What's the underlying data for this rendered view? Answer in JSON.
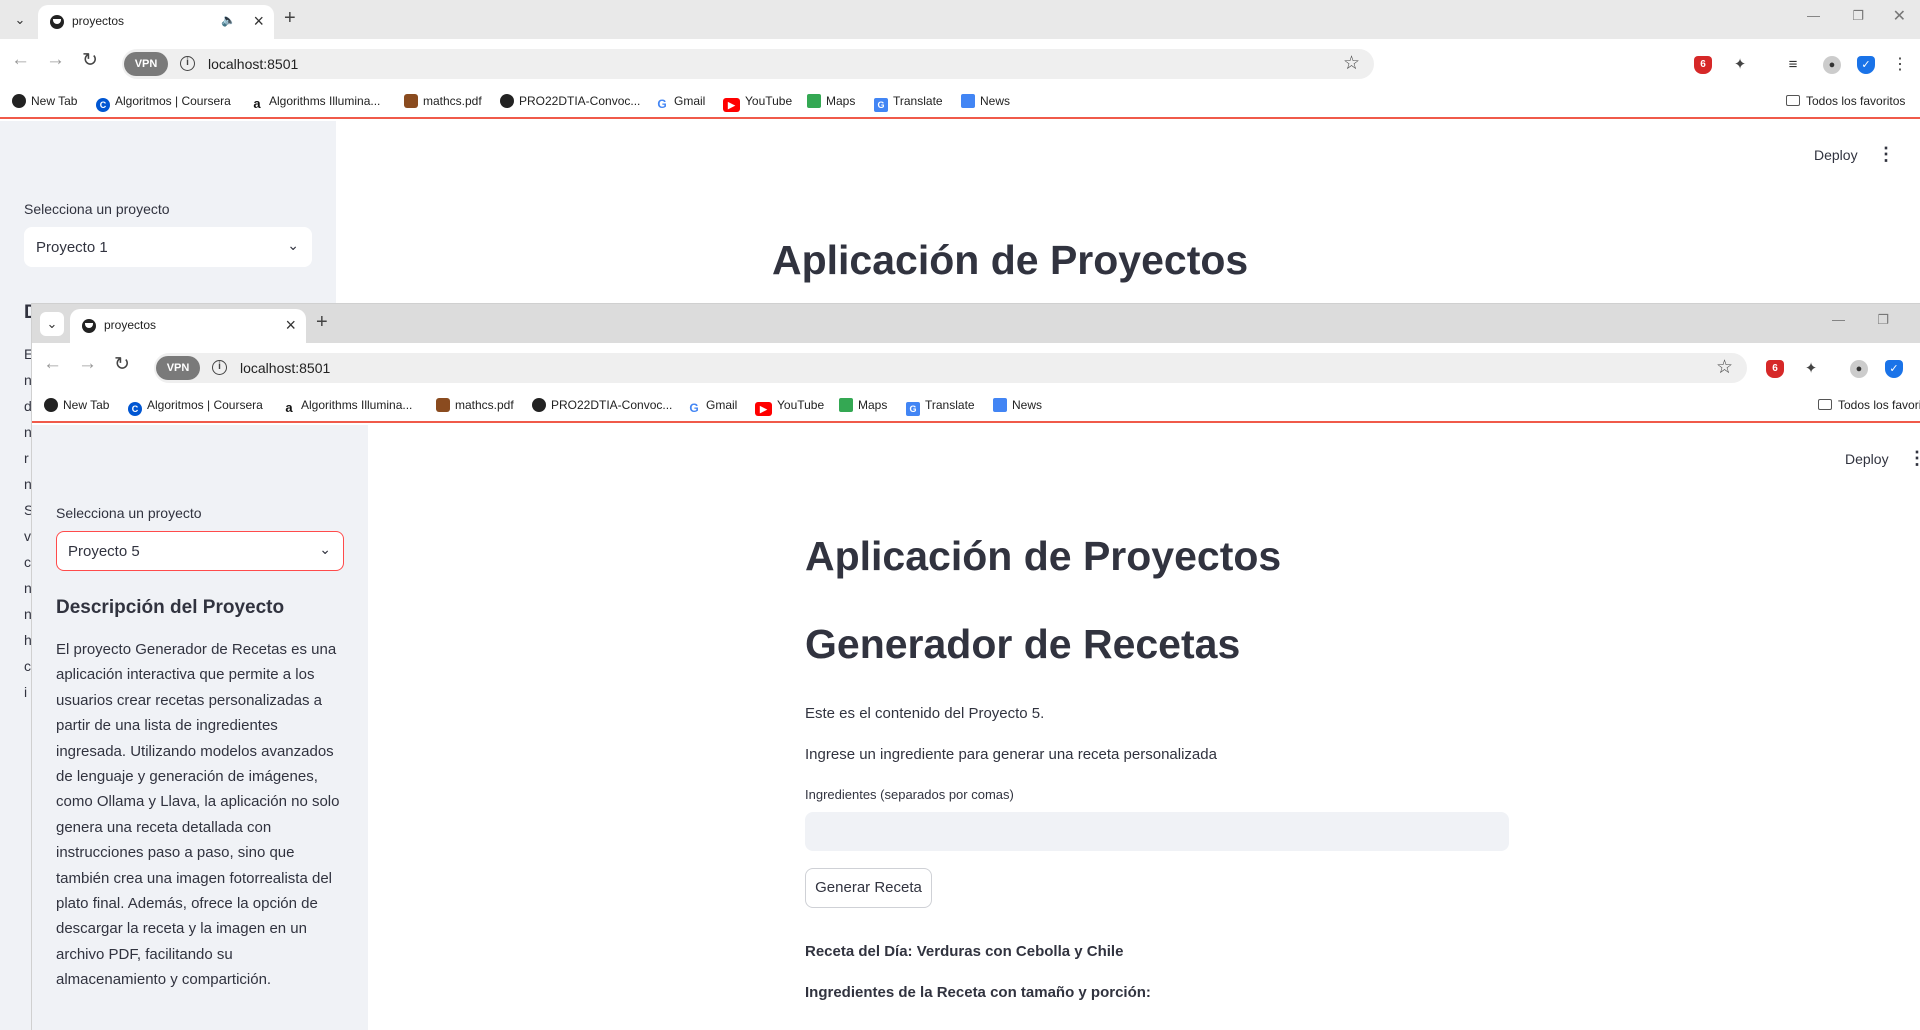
{
  "browser": {
    "tab_title": "proyectos",
    "url": "localhost:8501",
    "vpn_label": "VPN",
    "new_tab_symbol": "+",
    "bookmarks": [
      {
        "label": "New Tab",
        "icon": "globe-icon",
        "color": "#222222"
      },
      {
        "label": "Algoritmos | Coursera",
        "icon": "coursera-icon",
        "color": "#0056d2"
      },
      {
        "label": "Algorithms Illumina...",
        "icon": "amazon-icon",
        "color": "#111111"
      },
      {
        "label": "mathcs.pdf",
        "icon": "shield-crest-icon",
        "color": "#8a4b1f"
      },
      {
        "label": "PRO22DTIA-Convoc...",
        "icon": "globe-icon",
        "color": "#222222"
      },
      {
        "label": "Gmail",
        "icon": "google-icon",
        "color": "#4285f4"
      },
      {
        "label": "YouTube",
        "icon": "youtube-icon",
        "color": "#ff0000"
      },
      {
        "label": "Maps",
        "icon": "maps-icon",
        "color": "#34a853"
      },
      {
        "label": "Translate",
        "icon": "translate-icon",
        "color": "#4285f4"
      },
      {
        "label": "News",
        "icon": "news-icon",
        "color": "#4285f4"
      }
    ],
    "bookmarks_folder": "Todos los favoritos",
    "bookmarks_folder_front": "Todos los favori"
  },
  "app": {
    "deploy_label": "Deploy",
    "title": "Aplicación de Proyectos",
    "back": {
      "select_label": "Selecciona un proyecto",
      "select_value": "Proyecto 1",
      "desc_heading_initial": "D",
      "desc_letters": [
        "E",
        "n",
        "d",
        "n",
        "r",
        "n",
        "S",
        "v",
        "c",
        "n",
        "n",
        "h",
        "c",
        "i"
      ]
    },
    "front": {
      "select_label": "Selecciona un proyecto",
      "select_value": "Proyecto 5",
      "desc_heading": "Descripción del Proyecto",
      "desc_text": "El proyecto Generador de Recetas es una aplicación interactiva que permite a los usuarios crear recetas personalizadas a partir de una lista de ingredientes ingresada. Utilizando modelos avanzados de lenguaje y generación de imágenes, como Ollama y Llava, la aplicación no solo genera una receta detallada con instrucciones paso a paso, sino que también crea una imagen fotorrealista del plato final. Además, ofrece la opción de descargar la receta y la imagen en un archivo PDF, facilitando su almacenamiento y compartición.",
      "subtitle": "Generador de Recetas",
      "content_line": "Este es el contenido del Proyecto 5.",
      "prompt_line": "Ingrese un ingrediente para generar una receta personalizada",
      "input_label": "Ingredientes (separados por comas)",
      "input_value": "",
      "button_label": "Generar Receta",
      "recipe_title": "Receta del Día: Verduras con Cebolla y Chile",
      "ingredients_title": "Ingredientes de la Receta con tamaño y porción:"
    }
  }
}
